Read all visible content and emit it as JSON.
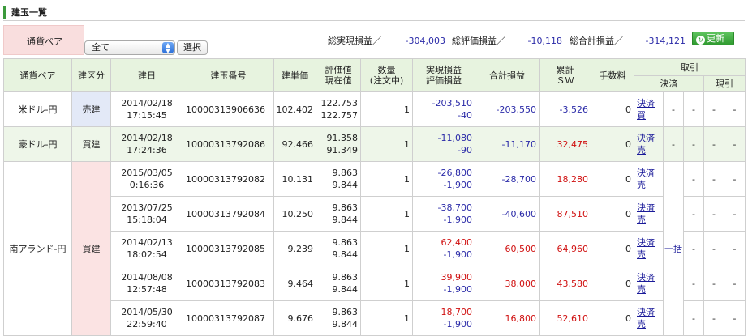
{
  "section_title": "建玉一覧",
  "filter": {
    "label": "通貨ペア",
    "selected": "全て",
    "select_button": "選択"
  },
  "summary": {
    "realized_label": "総実現損益／",
    "realized_value": "-304,003",
    "valuation_label": "総評価損益／",
    "valuation_value": "-10,118",
    "total_label": "総合計損益／",
    "total_value": "-314,121"
  },
  "refresh_button": "更新",
  "table": {
    "headers": {
      "pair": "通貨ペア",
      "side": "建区分",
      "date": "建日",
      "id": "建玉番号",
      "price": "建単価",
      "eval_top": "評価値",
      "eval_bottom": "現在値",
      "qty_top": "数量",
      "qty_bottom": "(注文中)",
      "pl_top": "実現損益",
      "pl_bottom": "評価損益",
      "total": "合計損益",
      "sw_top": "累計",
      "sw_bottom": "ＳＷ",
      "fee": "手数料",
      "trade": "取引",
      "settle": "決済",
      "receipt": "現引"
    },
    "groups": [
      {
        "pair": "米ドル-円",
        "side": "売建",
        "rows": [
          {
            "date": "2014/02/18",
            "time": "17:15:45",
            "id": "10000313906636",
            "price": "102.402",
            "eval": "122.753",
            "current": "122.757",
            "qty": "1",
            "realized": "-203,510",
            "valuation": "-40",
            "total": "-203,550",
            "sw": "-3,526",
            "fee": "0",
            "action": "決済買",
            "bulk": "-",
            "c1": "-",
            "c2": "-",
            "c3": "-"
          }
        ]
      },
      {
        "pair": "豪ドル-円",
        "side": "買建",
        "rows": [
          {
            "date": "2014/02/18",
            "time": "17:24:36",
            "id": "10000313792086",
            "price": "92.466",
            "eval": "91.358",
            "current": "91.349",
            "qty": "1",
            "realized": "-11,080",
            "valuation": "-90",
            "total": "-11,170",
            "sw": "32,475",
            "fee": "0",
            "action": "決済売",
            "bulk": "-",
            "c1": "-",
            "c2": "-",
            "c3": "-"
          }
        ]
      },
      {
        "pair": "南アランド-円",
        "side": "買建",
        "bulk": "一括",
        "rows": [
          {
            "date": "2015/03/05",
            "time": "0:16:36",
            "id": "10000313792082",
            "price": "10.131",
            "eval": "9.863",
            "current": "9.844",
            "qty": "1",
            "realized": "-26,800",
            "valuation": "-1,900",
            "total": "-28,700",
            "sw": "18,280",
            "fee": "0",
            "action": "決済売",
            "c1": "-",
            "c2": "-",
            "c3": "-"
          },
          {
            "date": "2013/07/25",
            "time": "15:18:04",
            "id": "10000313792084",
            "price": "10.250",
            "eval": "9.863",
            "current": "9.844",
            "qty": "1",
            "realized": "-38,700",
            "valuation": "-1,900",
            "total": "-40,600",
            "sw": "87,510",
            "fee": "0",
            "action": "決済売",
            "c1": "-",
            "c2": "-",
            "c3": "-"
          },
          {
            "date": "2014/02/13",
            "time": "18:02:54",
            "id": "10000313792085",
            "price": "9.239",
            "eval": "9.863",
            "current": "9.844",
            "qty": "1",
            "realized": "62,400",
            "valuation": "-1,900",
            "total": "60,500",
            "sw": "64,960",
            "fee": "0",
            "action": "決済売",
            "c1": "-",
            "c2": "-",
            "c3": "-"
          },
          {
            "date": "2014/08/08",
            "time": "12:57:48",
            "id": "10000313792083",
            "price": "9.464",
            "eval": "9.863",
            "current": "9.844",
            "qty": "1",
            "realized": "39,900",
            "valuation": "-1,900",
            "total": "38,000",
            "sw": "43,580",
            "fee": "0",
            "action": "決済売",
            "c1": "-",
            "c2": "-",
            "c3": "-"
          },
          {
            "date": "2014/05/30",
            "time": "22:59:40",
            "id": "10000313792087",
            "price": "9.676",
            "eval": "9.863",
            "current": "9.844",
            "qty": "1",
            "realized": "18,700",
            "valuation": "-1,900",
            "total": "16,800",
            "sw": "52,610",
            "fee": "0",
            "action": "決済売",
            "c1": "-",
            "c2": "-",
            "c3": "-"
          }
        ]
      }
    ]
  }
}
